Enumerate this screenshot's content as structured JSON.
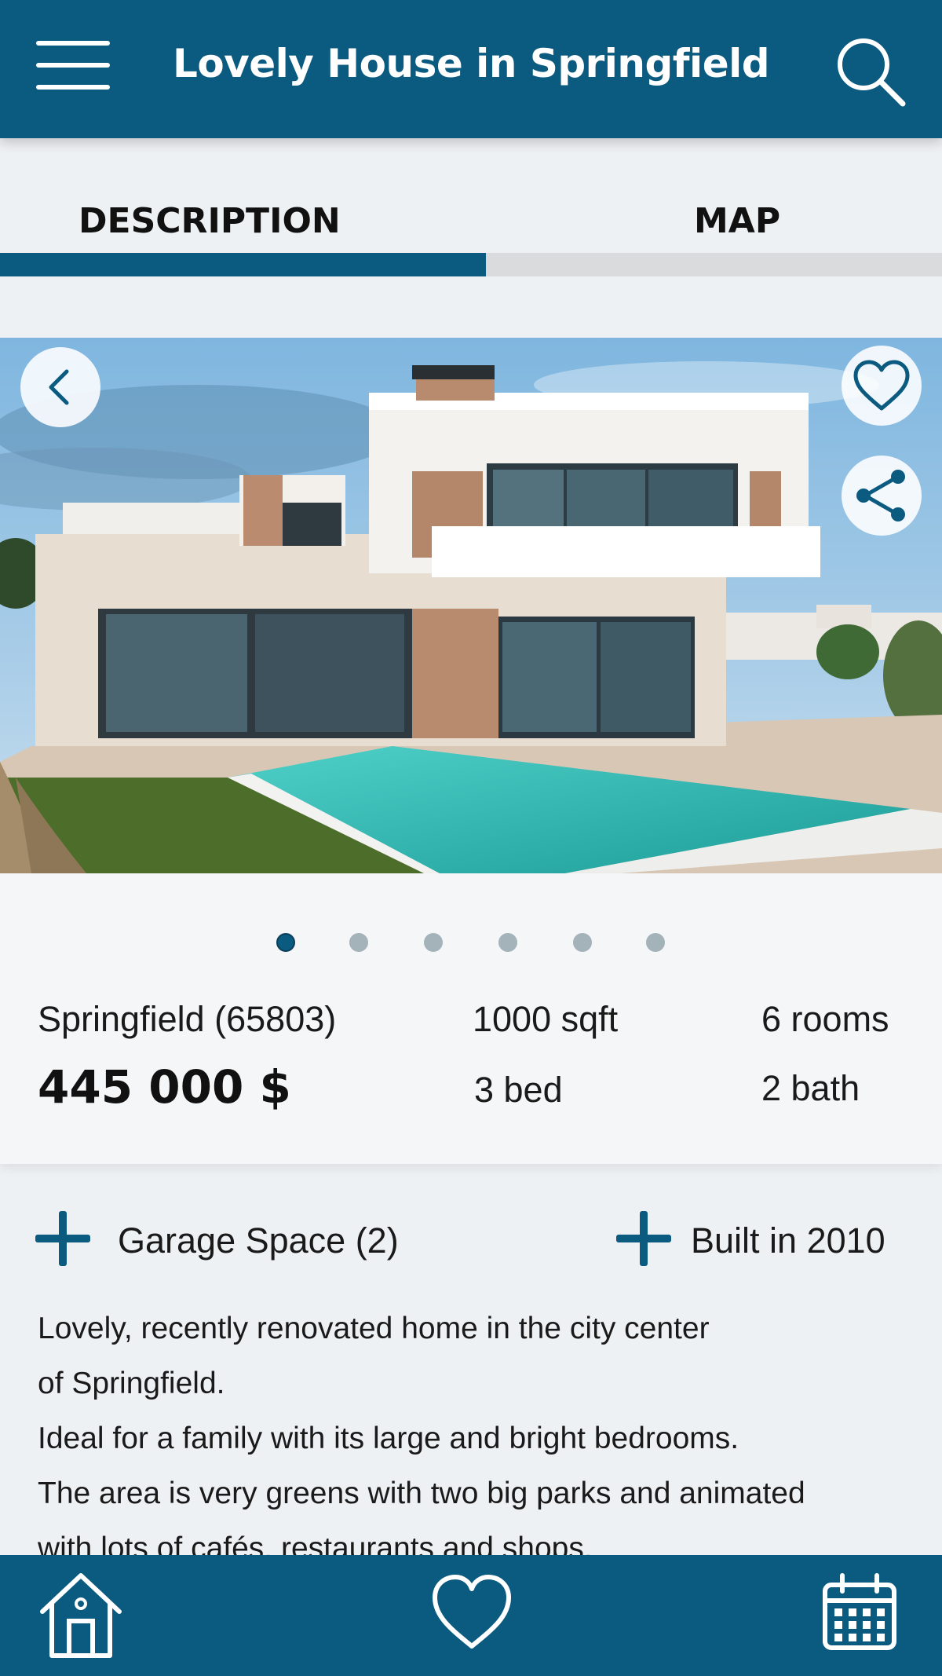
{
  "header": {
    "title": "Lovely House in Springfield",
    "menu_icon": "hamburger-menu-icon",
    "search_icon": "search-icon"
  },
  "tabs": [
    {
      "label": "DESCRIPTION",
      "active": true
    },
    {
      "label": "MAP",
      "active": false
    }
  ],
  "gallery": {
    "image": "modern-villa-with-pool-photo",
    "current_index": 1,
    "total": 6,
    "back_icon": "chevron-left-icon",
    "favorite_icon": "heart-icon",
    "share_icon": "share-icon"
  },
  "listing": {
    "location": "Springfield (65803)",
    "price": "445 000 $",
    "area": "1000 sqft",
    "bedrooms": "3 bed",
    "rooms": "6 rooms",
    "bathrooms": "2 bath"
  },
  "features": [
    {
      "label": "Garage Space (2)",
      "icon": "plus-icon"
    },
    {
      "label": "Built in 2010",
      "icon": "plus-icon"
    }
  ],
  "description": {
    "lines": [
      "Lovely, recently renovated home in the city center",
      "of Springfield.",
      "Ideal for a family with its large and bright bedrooms.",
      "The area is very greens with two big parks and animated",
      "with lots of cafés, restaurants and shops."
    ]
  },
  "bottom_nav": [
    {
      "icon": "home-icon"
    },
    {
      "icon": "heart-icon"
    },
    {
      "icon": "calendar-icon"
    }
  ],
  "colors": {
    "brand": "#0b5a80",
    "background": "#eef1f3",
    "dot_inactive": "#a4b2ba"
  }
}
